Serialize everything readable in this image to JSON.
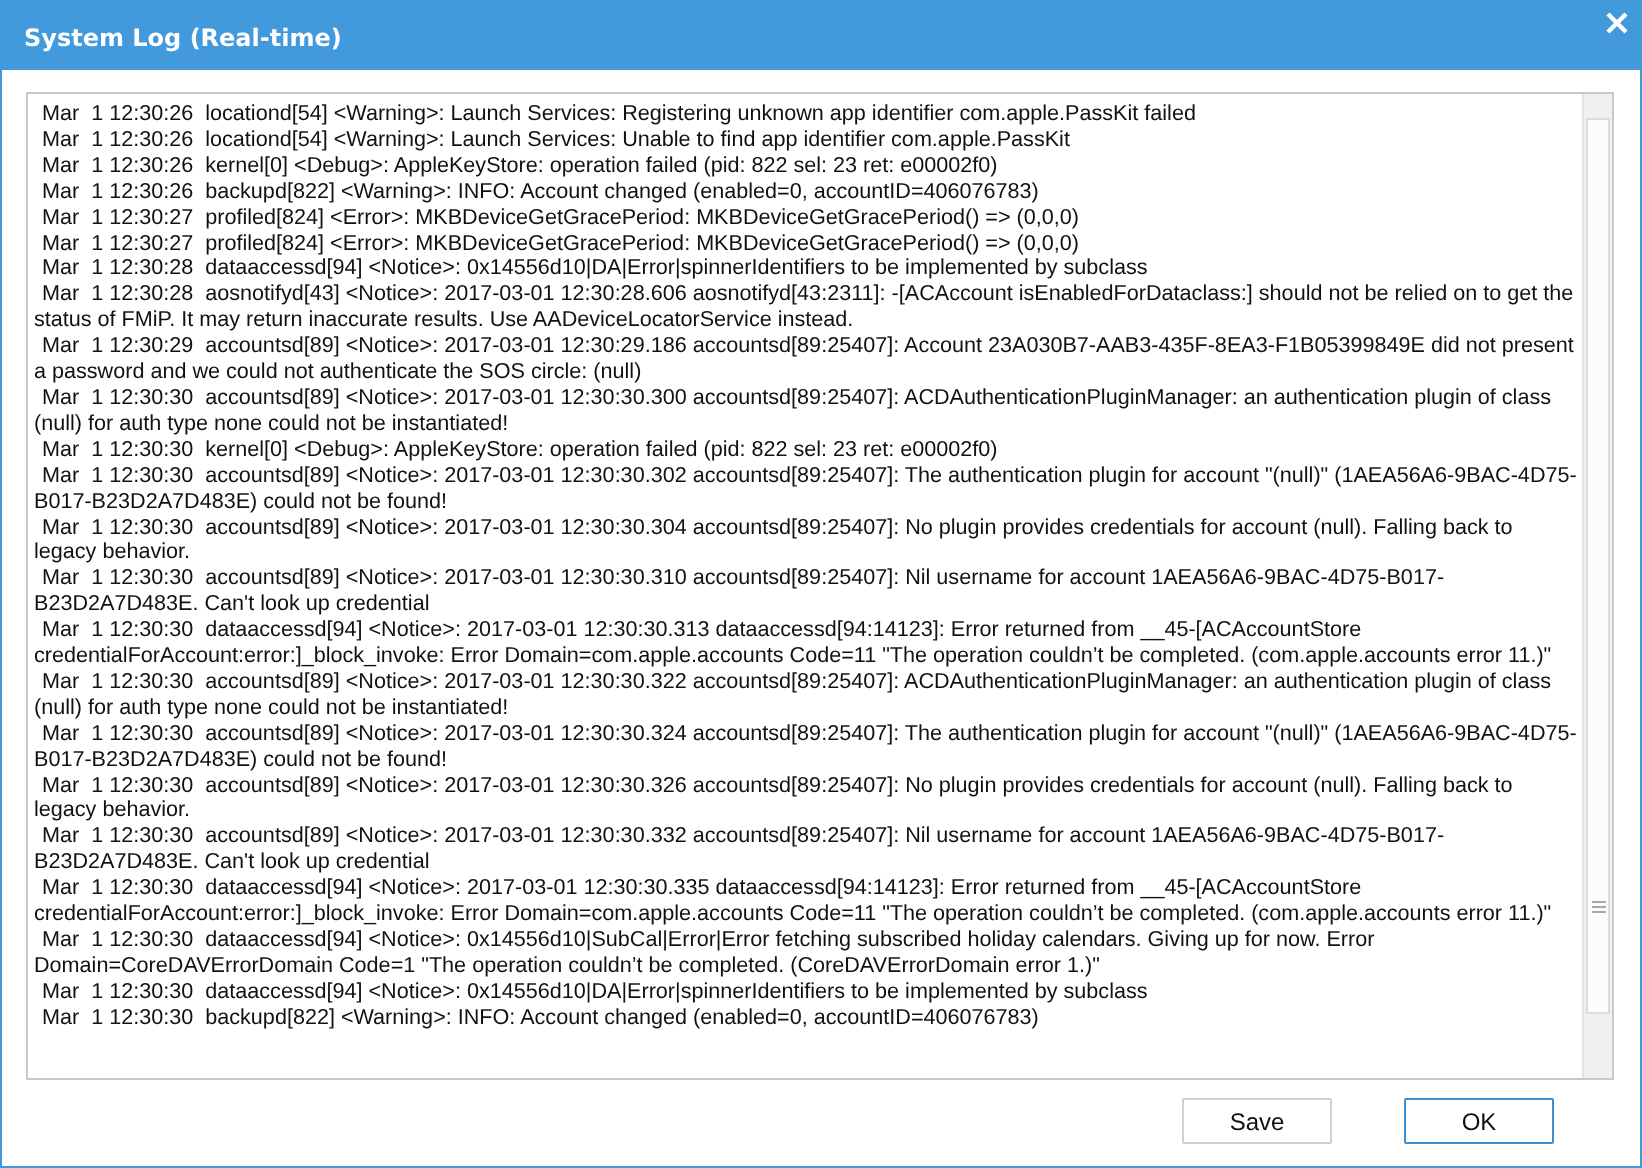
{
  "window": {
    "title": "System Log (Real-time)"
  },
  "log_entries": [
    "Mar  1 12:30:26  locationd[54] <Warning>: Launch Services: Registering unknown app identifier com.apple.PassKit failed",
    "Mar  1 12:30:26  locationd[54] <Warning>: Launch Services: Unable to find app identifier com.apple.PassKit",
    "Mar  1 12:30:26  kernel[0] <Debug>: AppleKeyStore: operation failed (pid: 822 sel: 23 ret: e00002f0)",
    "Mar  1 12:30:26  backupd[822] <Warning>: INFO: Account changed (enabled=0, accountID=406076783)",
    "Mar  1 12:30:27  profiled[824] <Error>: MKBDeviceGetGracePeriod: MKBDeviceGetGracePeriod() => (0,0,0)",
    "Mar  1 12:30:27  profiled[824] <Error>: MKBDeviceGetGracePeriod: MKBDeviceGetGracePeriod() => (0,0,0)",
    "Mar  1 12:30:28  dataaccessd[94] <Notice>: 0x14556d10|DA|Error|spinnerIdentifiers to be implemented by subclass",
    "Mar  1 12:30:28  aosnotifyd[43] <Notice>: 2017-03-01 12:30:28.606 aosnotifyd[43:2311]: -[ACAccount isEnabledForDataclass:] should not be relied on to get the status of FMiP. It may return inaccurate results. Use AADeviceLocatorService instead.",
    "Mar  1 12:30:29  accountsd[89] <Notice>: 2017-03-01 12:30:29.186 accountsd[89:25407]: Account 23A030B7-AAB3-435F-8EA3-F1B05399849E did not present a password and we could not authenticate the SOS circle: (null)",
    "Mar  1 12:30:30  accountsd[89] <Notice>: 2017-03-01 12:30:30.300 accountsd[89:25407]: ACDAuthenticationPluginManager: an authentication plugin of class (null) for auth type none could not be instantiated!",
    "Mar  1 12:30:30  kernel[0] <Debug>: AppleKeyStore: operation failed (pid: 822 sel: 23 ret: e00002f0)",
    "Mar  1 12:30:30  accountsd[89] <Notice>: 2017-03-01 12:30:30.302 accountsd[89:25407]: The authentication plugin for account \"(null)\" (1AEA56A6-9BAC-4D75-B017-B23D2A7D483E) could not be found!",
    "Mar  1 12:30:30  accountsd[89] <Notice>: 2017-03-01 12:30:30.304 accountsd[89:25407]: No plugin provides credentials for account (null). Falling back to legacy behavior.",
    "Mar  1 12:30:30  accountsd[89] <Notice>: 2017-03-01 12:30:30.310 accountsd[89:25407]: Nil username for account 1AEA56A6-9BAC-4D75-B017-B23D2A7D483E. Can't look up credential",
    "Mar  1 12:30:30  dataaccessd[94] <Notice>: 2017-03-01 12:30:30.313 dataaccessd[94:14123]: Error returned from __45-[ACAccountStore credentialForAccount:error:]_block_invoke: Error Domain=com.apple.accounts Code=11 \"The operation couldn’t be completed. (com.apple.accounts error 11.)\"",
    "Mar  1 12:30:30  accountsd[89] <Notice>: 2017-03-01 12:30:30.322 accountsd[89:25407]: ACDAuthenticationPluginManager: an authentication plugin of class (null) for auth type none could not be instantiated!",
    "Mar  1 12:30:30  accountsd[89] <Notice>: 2017-03-01 12:30:30.324 accountsd[89:25407]: The authentication plugin for account \"(null)\" (1AEA56A6-9BAC-4D75-B017-B23D2A7D483E) could not be found!",
    "Mar  1 12:30:30  accountsd[89] <Notice>: 2017-03-01 12:30:30.326 accountsd[89:25407]: No plugin provides credentials for account (null). Falling back to legacy behavior.",
    "Mar  1 12:30:30  accountsd[89] <Notice>: 2017-03-01 12:30:30.332 accountsd[89:25407]: Nil username for account 1AEA56A6-9BAC-4D75-B017-B23D2A7D483E. Can't look up credential",
    "Mar  1 12:30:30  dataaccessd[94] <Notice>: 2017-03-01 12:30:30.335 dataaccessd[94:14123]: Error returned from __45-[ACAccountStore credentialForAccount:error:]_block_invoke: Error Domain=com.apple.accounts Code=11 \"The operation couldn’t be completed. (com.apple.accounts error 11.)\"",
    "Mar  1 12:30:30  dataaccessd[94] <Notice>: 0x14556d10|SubCal|Error|Error fetching subscribed holiday calendars. Giving up for now. Error Domain=CoreDAVErrorDomain Code=1 \"The operation couldn’t be completed. (CoreDAVErrorDomain error 1.)\"",
    "Mar  1 12:30:30  dataaccessd[94] <Notice>: 0x14556d10|DA|Error|spinnerIdentifiers to be implemented by subclass",
    "Mar  1 12:30:30  backupd[822] <Warning>: INFO: Account changed (enabled=0, accountID=406076783)"
  ],
  "buttons": [
    {
      "label": "Save",
      "kind": "normal"
    },
    {
      "label": "OK",
      "kind": "default"
    }
  ]
}
